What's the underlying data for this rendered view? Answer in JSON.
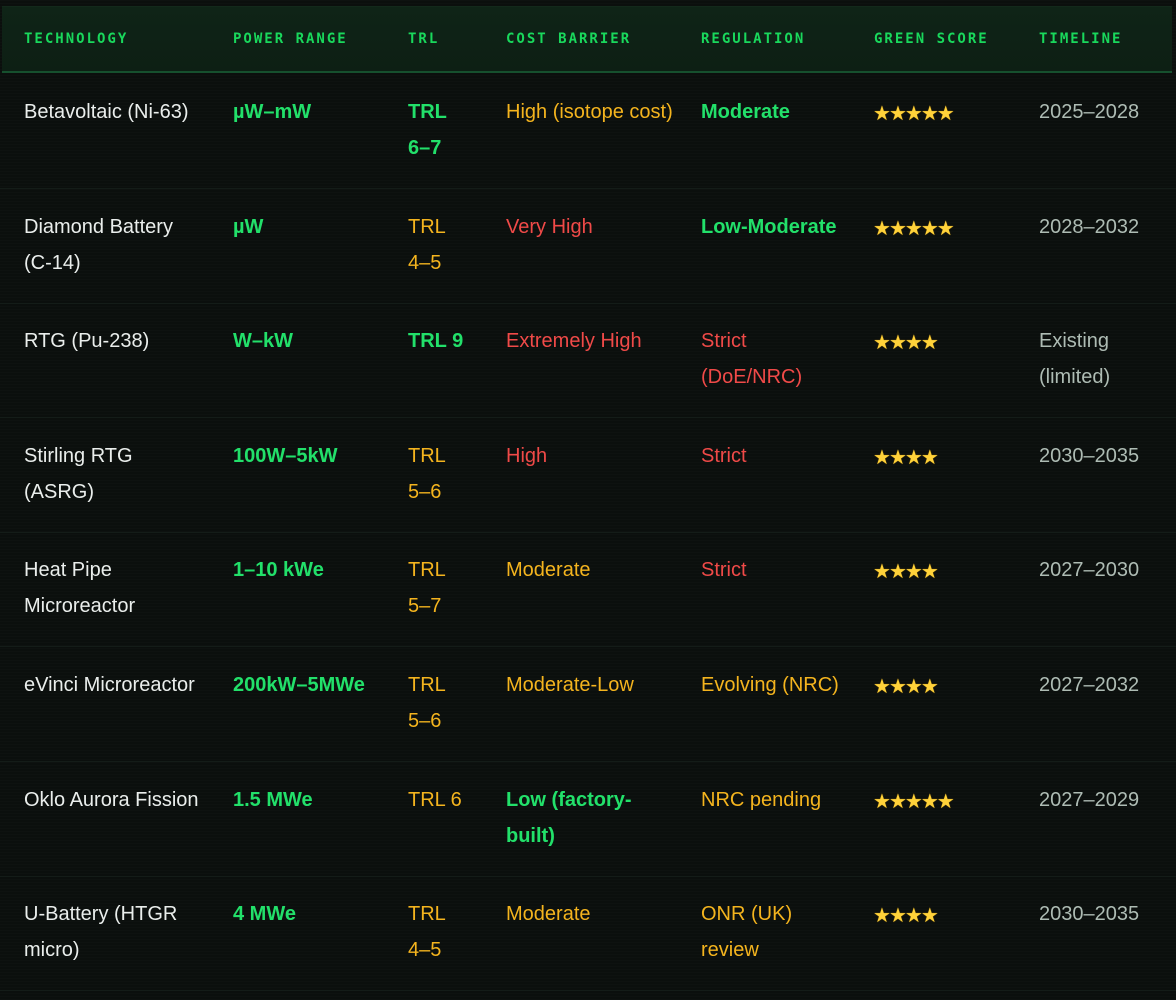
{
  "headers": {
    "technology": "TECHNOLOGY",
    "power_range": "POWER RANGE",
    "trl": "TRL",
    "cost_barrier": "COST BARRIER",
    "regulation": "REGULATION",
    "green_score": "GREEN SCORE",
    "timeline": "TIMELINE"
  },
  "colors": {
    "accent_green": "#22e06a",
    "amber": "#f4b41e",
    "red": "#f04a48",
    "star": "#ffd23a"
  },
  "rows": [
    {
      "technology": "Betavoltaic (Ni-63)",
      "power_range": "µW–mW",
      "trl": "TRL 6–7",
      "trl_status": "green",
      "cost_barrier": "High (isotope cost)",
      "cost_status": "amber",
      "regulation": "Moderate",
      "regulation_status": "green",
      "green_score": "⭐⭐⭐⭐⭐",
      "green_score_value": 5,
      "timeline": "2025–2028"
    },
    {
      "technology": "Diamond Battery (C-14)",
      "power_range": "µW",
      "trl": "TRL 4–5",
      "trl_status": "amber",
      "cost_barrier": "Very High",
      "cost_status": "red",
      "regulation": "Low-Moderate",
      "regulation_status": "green",
      "green_score": "⭐⭐⭐⭐⭐",
      "green_score_value": 5,
      "timeline": "2028–2032"
    },
    {
      "technology": "RTG (Pu-238)",
      "power_range": "W–kW",
      "trl": "TRL 9",
      "trl_status": "green",
      "cost_barrier": "Extremely High",
      "cost_status": "red",
      "regulation": "Strict (DoE/NRC)",
      "regulation_status": "red",
      "green_score": "⭐⭐⭐⭐",
      "green_score_value": 4,
      "timeline": "Existing (limited)"
    },
    {
      "technology": "Stirling RTG (ASRG)",
      "power_range": "100W–5kW",
      "trl": "TRL 5–6",
      "trl_status": "amber",
      "cost_barrier": "High",
      "cost_status": "red",
      "regulation": "Strict",
      "regulation_status": "red",
      "green_score": "⭐⭐⭐⭐",
      "green_score_value": 4,
      "timeline": "2030–2035"
    },
    {
      "technology": "Heat Pipe Microreactor",
      "power_range": "1–10 kWe",
      "trl": "TRL 5–7",
      "trl_status": "amber",
      "cost_barrier": "Moderate",
      "cost_status": "amber",
      "regulation": "Strict",
      "regulation_status": "red",
      "green_score": "⭐⭐⭐⭐",
      "green_score_value": 4,
      "timeline": "2027–2030"
    },
    {
      "technology": "eVinci Microreactor",
      "power_range": "200kW–5MWe",
      "trl": "TRL 5–6",
      "trl_status": "amber",
      "cost_barrier": "Moderate-Low",
      "cost_status": "amber",
      "regulation": "Evolving (NRC)",
      "regulation_status": "amber",
      "green_score": "⭐⭐⭐⭐",
      "green_score_value": 4,
      "timeline": "2027–2032"
    },
    {
      "technology": "Oklo Aurora Fission",
      "power_range": "1.5 MWe",
      "trl": "TRL 6",
      "trl_status": "amber",
      "cost_barrier": "Low (factory-built)",
      "cost_status": "green",
      "regulation": "NRC pending",
      "regulation_status": "amber",
      "green_score": "⭐⭐⭐⭐⭐",
      "green_score_value": 5,
      "timeline": "2027–2029"
    },
    {
      "technology": "U-Battery (HTGR micro)",
      "power_range": "4 MWe",
      "trl": "TRL 4–5",
      "trl_status": "amber",
      "cost_barrier": "Moderate",
      "cost_status": "amber",
      "regulation": "ONR (UK) review",
      "regulation_status": "amber",
      "green_score": "⭐⭐⭐⭐",
      "green_score_value": 4,
      "timeline": "2030–2035"
    }
  ]
}
